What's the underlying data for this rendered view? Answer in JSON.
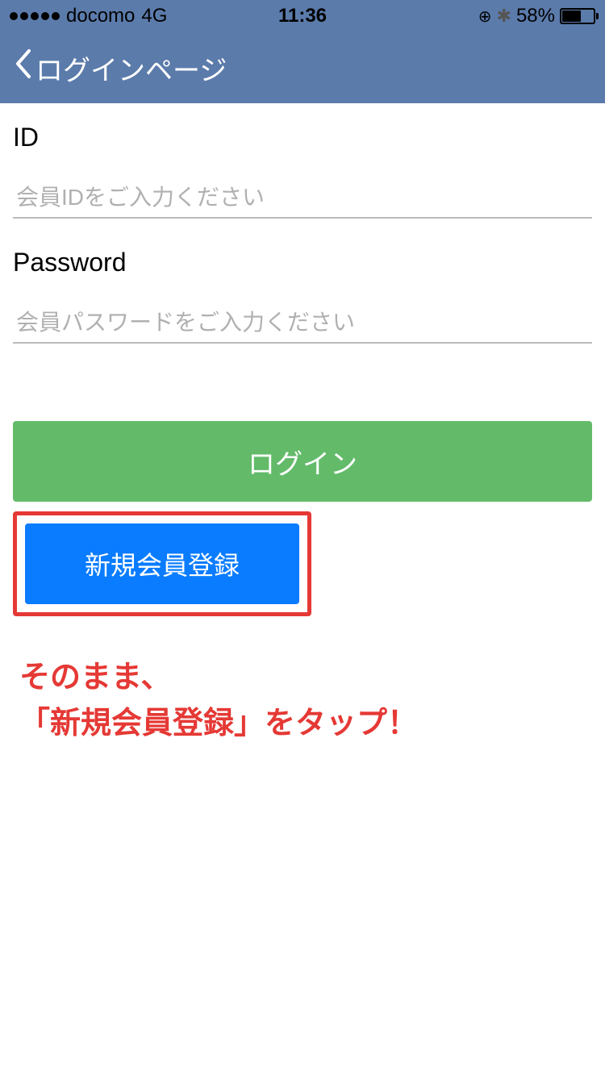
{
  "status_bar": {
    "carrier": "docomo",
    "network": "4G",
    "time": "11:36",
    "battery_percent": "58%"
  },
  "nav": {
    "title": "ログインページ"
  },
  "form": {
    "id_label": "ID",
    "id_placeholder": "会員IDをご入力ください",
    "password_label": "Password",
    "password_placeholder": "会員パスワードをご入力ください"
  },
  "buttons": {
    "login": "ログイン",
    "register": "新規会員登録"
  },
  "annotation": {
    "line1": "そのまま、",
    "line2": "「新規会員登録」をタップ！"
  }
}
